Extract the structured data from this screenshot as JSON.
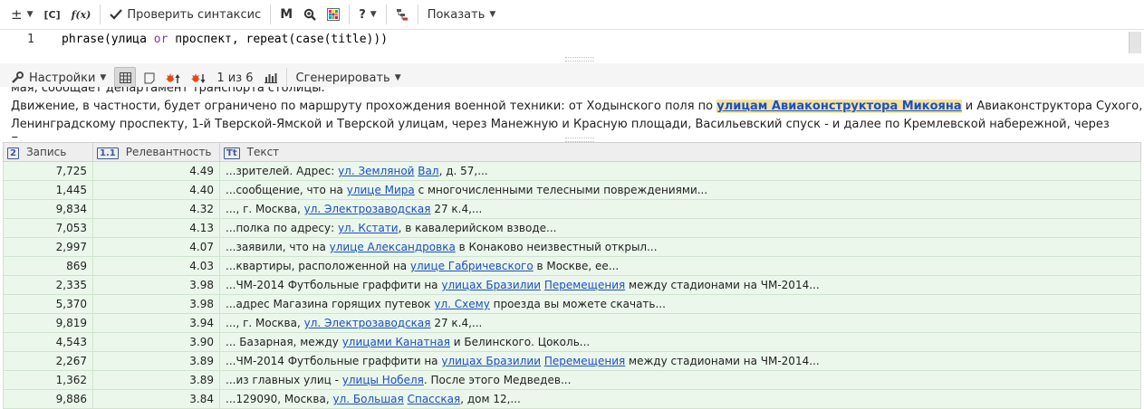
{
  "toolbar": {
    "plusminus": "±",
    "bracket_c": "[C]",
    "fx": "f(x)",
    "check_syntax": "Проверить синтаксис",
    "m": "M",
    "help": "?",
    "show": "Показать"
  },
  "editor": {
    "line_number": "1",
    "code_parts": [
      "phrase(улица ",
      "or",
      " проспект, repeat(case(title)))"
    ]
  },
  "toolbar2": {
    "settings": "Настройки",
    "page_info": "1 из 6",
    "generate": "Сгенерировать"
  },
  "snippet": {
    "line0": "мая, сообщает департамент транспорта столицы.",
    "line1_pre": "Движение, в частности, будет ограничено по маршруту прохождения военной техники: от Ходынского поля по ",
    "line1_hl": "улицам Авиаконструктора Микояна",
    "line1_post": " и Авиаконструктора Сухого,",
    "line2": "Ленинградскому проспекту, 1-й Тверской-Ямской и Тверской улицам, через Манежную и Красную площади, Васильевский спуск - и далее по Кремлевской набережной, через Боровицкую"
  },
  "table": {
    "headers": [
      {
        "badge": "2",
        "label": "Запись"
      },
      {
        "badge": "1.1",
        "label": "Релевантность"
      },
      {
        "badge": "Tt",
        "label": "Текст"
      }
    ],
    "rows": [
      {
        "record": "7,725",
        "relevance": "4.49",
        "parts": [
          {
            "t": "...зрителей. Адрес: "
          },
          {
            "t": "ул. Земляной",
            "link": true
          },
          {
            "t": " "
          },
          {
            "t": "Вал",
            "link": true
          },
          {
            "t": ", д. 57,..."
          }
        ]
      },
      {
        "record": "1,445",
        "relevance": "4.40",
        "parts": [
          {
            "t": "...сообщение, что на "
          },
          {
            "t": "улице Мира",
            "link": true
          },
          {
            "t": " с многочисленными телесными повреждениями..."
          }
        ]
      },
      {
        "record": "9,834",
        "relevance": "4.32",
        "parts": [
          {
            "t": "..., г. Москва, "
          },
          {
            "t": "ул. Электрозаводская",
            "link": true
          },
          {
            "t": " 27 к.4,..."
          }
        ]
      },
      {
        "record": "7,053",
        "relevance": "4.13",
        "parts": [
          {
            "t": "...полка по адресу: "
          },
          {
            "t": "ул. Кстати",
            "link": true
          },
          {
            "t": ", в кавалерийском взводе..."
          }
        ]
      },
      {
        "record": "2,997",
        "relevance": "4.07",
        "parts": [
          {
            "t": "...заявили, что на "
          },
          {
            "t": "улице Александровка",
            "link": true
          },
          {
            "t": " в Конаково неизвестный открыл..."
          }
        ]
      },
      {
        "record": "869",
        "relevance": "4.03",
        "parts": [
          {
            "t": "...квартиры, расположенной на "
          },
          {
            "t": "улице Габричевского",
            "link": true
          },
          {
            "t": " в Москве, ее..."
          }
        ]
      },
      {
        "record": "2,335",
        "relevance": "3.98",
        "parts": [
          {
            "t": "...ЧМ-2014 Футбольные граффити на "
          },
          {
            "t": "улицах Бразилии",
            "link": true
          },
          {
            "t": " "
          },
          {
            "t": "Перемещения",
            "link": true
          },
          {
            "t": " между стадионами на ЧМ-2014..."
          }
        ]
      },
      {
        "record": "5,370",
        "relevance": "3.98",
        "parts": [
          {
            "t": "...адрес Магазина горящих путевок "
          },
          {
            "t": "ул. Схему",
            "link": true
          },
          {
            "t": " проезда вы можете скачать..."
          }
        ]
      },
      {
        "record": "9,819",
        "relevance": "3.94",
        "parts": [
          {
            "t": "..., г. Москва, "
          },
          {
            "t": "ул. Электрозаводская",
            "link": true
          },
          {
            "t": " 27 к.4,..."
          }
        ]
      },
      {
        "record": "4,543",
        "relevance": "3.90",
        "parts": [
          {
            "t": "... Базарная, между "
          },
          {
            "t": "улицами Канатная",
            "link": true
          },
          {
            "t": " и Белинского. Цоколь..."
          }
        ]
      },
      {
        "record": "2,267",
        "relevance": "3.89",
        "parts": [
          {
            "t": "...ЧМ-2014 Футбольные граффити на "
          },
          {
            "t": "улицах Бразилии",
            "link": true
          },
          {
            "t": " "
          },
          {
            "t": "Перемещения",
            "link": true
          },
          {
            "t": " между стадионами на ЧМ-2014..."
          }
        ]
      },
      {
        "record": "1,362",
        "relevance": "3.89",
        "parts": [
          {
            "t": "...из главных улиц - "
          },
          {
            "t": "улицы Нобеля",
            "link": true
          },
          {
            "t": ". После этого Медведев..."
          }
        ]
      },
      {
        "record": "9,886",
        "relevance": "3.84",
        "parts": [
          {
            "t": "...129090, Москва, "
          },
          {
            "t": "ул. Большая",
            "link": true
          },
          {
            "t": " "
          },
          {
            "t": "Спасская",
            "link": true
          },
          {
            "t": ", дом 12,..."
          }
        ]
      }
    ]
  },
  "colors": {
    "row_bg": "#ebf7eb",
    "link": "#1a4fc9",
    "highlight_bg": "#f3e3a1"
  }
}
